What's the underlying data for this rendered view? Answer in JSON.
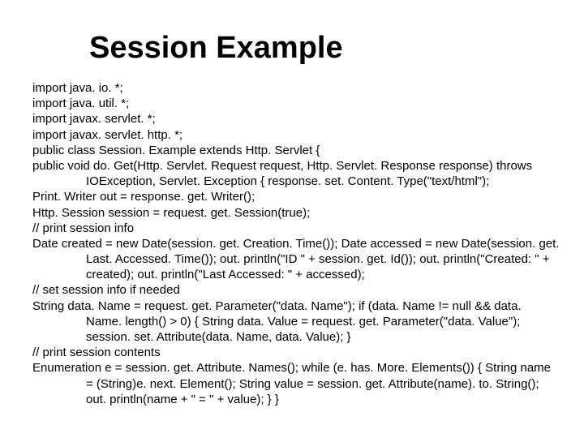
{
  "title": "Session Example",
  "code_lines": [
    "import java. io. *;",
    " import java. util. *;",
    "  import javax. servlet. *;",
    " import javax. servlet. http. *;",
    "  public class Session. Example extends Http. Servlet {",
    " public void do. Get(Http. Servlet. Request request, Http. Servlet. Response response) throws IOException, Servlet. Exception { response. set. Content. Type(\"text/html\");",
    "   Print. Writer out = response. get. Writer();",
    "  Http. Session session = request. get. Session(true);",
    "  // print session info",
    " Date created = new Date(session. get. Creation. Time()); Date accessed = new Date(session. get. Last. Accessed. Time()); out. println(\"ID \" + session. get. Id()); out. println(\"Created: \" + created); out. println(\"Last Accessed: \" + accessed);",
    " // set session info if needed",
    " String data. Name = request. get. Parameter(\"data. Name\"); if (data. Name != null && data. Name. length() > 0) { String data. Value = request. get. Parameter(\"data. Value\"); session. set. Attribute(data. Name, data. Value); }",
    " // print session contents",
    " Enumeration e = session. get. Attribute. Names(); while (e. has. More. Elements()) { String name = (String)e. next. Element(); String value = session. get. Attribute(name). to. String(); out. println(name + \" = \" + value); } }"
  ]
}
